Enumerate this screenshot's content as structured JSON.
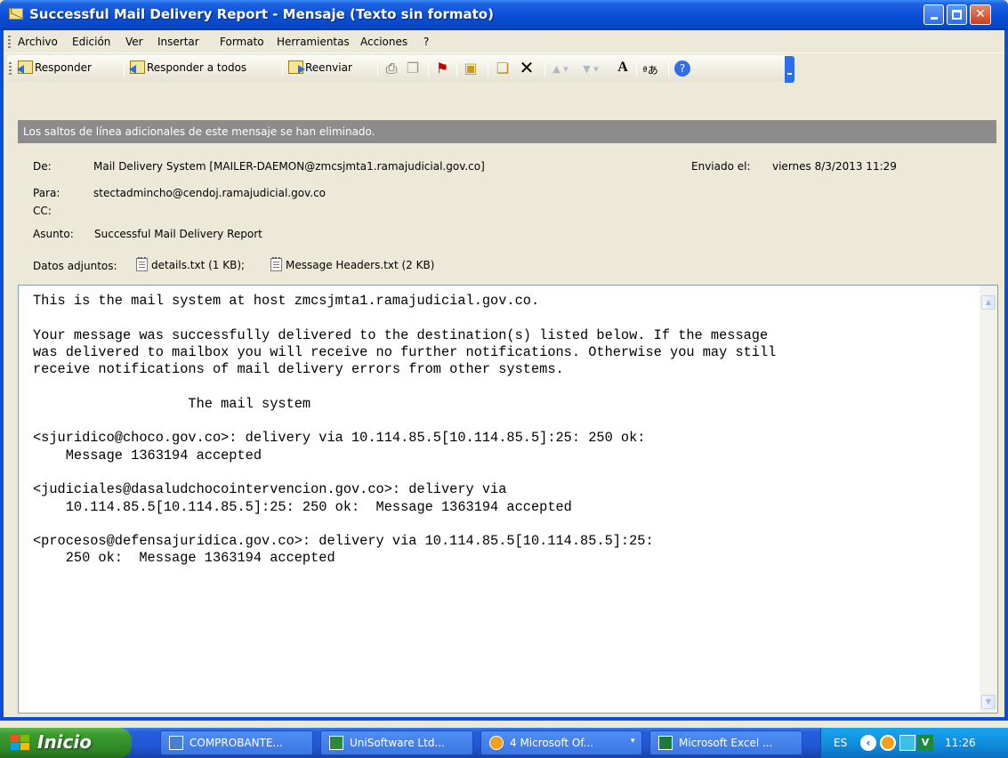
{
  "window": {
    "title": "Successful Mail Delivery Report - Mensaje (Texto sin formato)"
  },
  "menu": [
    "Archivo",
    "Edición",
    "Ver",
    "Insertar",
    "Formato",
    "Herramientas",
    "Acciones",
    "?"
  ],
  "toolbar": {
    "reply": "Responder",
    "reply_all": "Responder a todos",
    "forward": "Reenviar"
  },
  "infobar": "Los saltos de línea adicionales de este mensaje se han eliminado.",
  "header": {
    "from_label": "De:",
    "from_value": "Mail Delivery System [MAILER-DAEMON@zmcsjmta1.ramajudicial.gov.co]",
    "sent_label": "Enviado el:",
    "sent_value": "viernes 8/3/2013 11:29",
    "to_label": "Para:",
    "to_value": "stectadmincho@cendoj.ramajudicial.gov.co",
    "cc_label": "CC:",
    "subject_label": "Asunto:",
    "subject_value": "Successful Mail Delivery Report",
    "attachments_label": "Datos adjuntos:",
    "attachment_1": "details.txt (1 KB);",
    "attachment_2": "Message Headers.txt (2 KB)"
  },
  "body": "This is the mail system at host zmcsjmta1.ramajudicial.gov.co.\n\nYour message was successfully delivered to the destination(s) listed below. If the message\nwas delivered to mailbox you will receive no further notifications. Otherwise you may still\nreceive notifications of mail delivery errors from other systems.\n\n                   The mail system\n\n<sjuridico@choco.gov.co>: delivery via 10.114.85.5[10.114.85.5]:25: 250 ok:\n    Message 1363194 accepted\n\n<judiciales@dasaludchocointervencion.gov.co>: delivery via\n    10.114.85.5[10.114.85.5]:25: 250 ok:  Message 1363194 accepted\n\n<procesos@defensajuridica.gov.co>: delivery via 10.114.85.5[10.114.85.5]:25:\n    250 ok:  Message 1363194 accepted",
  "taskbar": {
    "start": "Inicio",
    "tasks": [
      "COMPROBANTE...",
      "UniSoftware Ltd...",
      "4 Microsoft Of...",
      "Microsoft Excel ..."
    ],
    "lang": "ES",
    "clock": "11:26"
  },
  "colors": {
    "titlebar": "#0a4fd8",
    "infobar": "#8c8c8c",
    "start": "#3d9c32",
    "taskbar": "#245edb"
  }
}
